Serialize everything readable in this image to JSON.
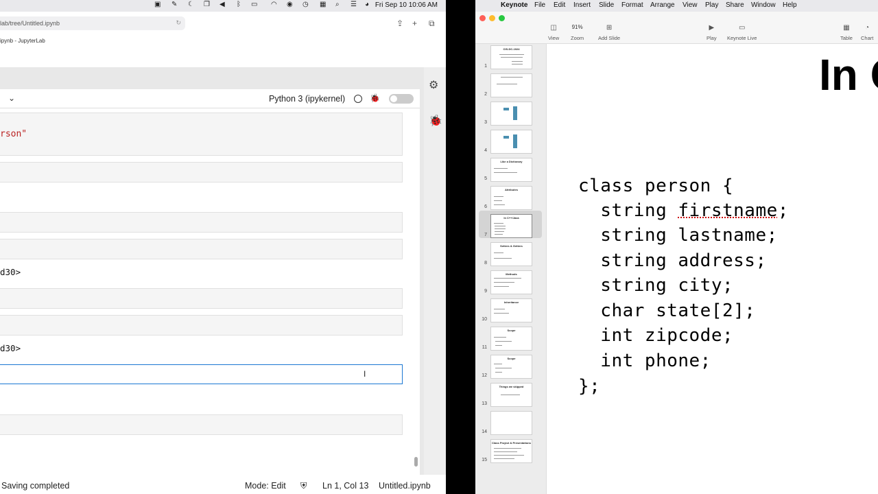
{
  "left_window": {
    "menubar_clock": "Fri Sep 10  10:06 AM",
    "address": "lab/tree/Untitled.ipynb",
    "tab_title": "ipynb - JupyterLab",
    "kernel": "Python 3 (ipykernel)",
    "cells": {
      "code_fragment": "rson\"",
      "output_1": "d30>",
      "output_2": "d30>"
    },
    "statusbar": {
      "saving": "Saving completed",
      "mode": "Mode: Edit",
      "position": "Ln 1, Col 13",
      "filename": "Untitled.ipynb"
    }
  },
  "keynote": {
    "menubar": {
      "app": "Keynote",
      "items": [
        "File",
        "Edit",
        "Insert",
        "Slide",
        "Format",
        "Arrange",
        "View",
        "Play",
        "Share",
        "Window",
        "Help"
      ]
    },
    "toolbar": {
      "view": "View",
      "zoom_value": "91%",
      "zoom": "Zoom",
      "add_slide": "Add Slide",
      "play": "Play",
      "keynote_live": "Keynote Live",
      "table": "Table",
      "chart": "Chart"
    },
    "slides": [
      {
        "num": "1",
        "title": "CIS-DC-1024"
      },
      {
        "num": "2",
        "title": ""
      },
      {
        "num": "3",
        "title": ""
      },
      {
        "num": "4",
        "title": ""
      },
      {
        "num": "5",
        "title": "Like a Dictionary"
      },
      {
        "num": "6",
        "title": "Attributes"
      },
      {
        "num": "7",
        "title": "In C++/Java"
      },
      {
        "num": "8",
        "title": "Setters & Getters"
      },
      {
        "num": "9",
        "title": "Methods"
      },
      {
        "num": "10",
        "title": "Inheritance"
      },
      {
        "num": "11",
        "title": "Scope"
      },
      {
        "num": "12",
        "title": "Scope"
      },
      {
        "num": "13",
        "title": "Things we skipped"
      },
      {
        "num": "14",
        "title": ""
      },
      {
        "num": "15",
        "title": "Class Project & Presentations"
      }
    ],
    "selected_slide": "7",
    "slide_title": "In C",
    "code": {
      "l1": "class person {",
      "l2a": "  string ",
      "l2b": "firstname",
      "l2c": ";",
      "l3": "  string lastname;",
      "l4": "  string address;",
      "l5": "  string city;",
      "l6": "  char state[2];",
      "l7": "  int zipcode;",
      "l8": "  int phone;",
      "l9": "};"
    }
  }
}
